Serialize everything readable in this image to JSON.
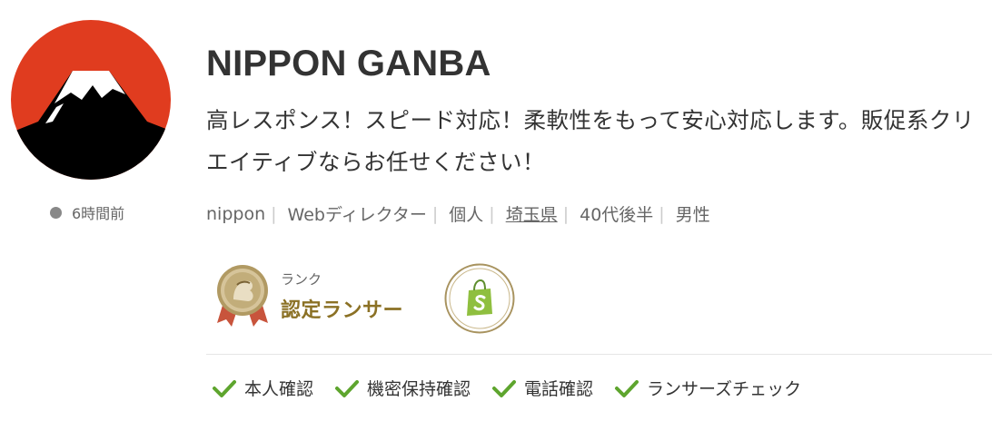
{
  "profile": {
    "name": "NIPPON GANBA",
    "catchphrase": "高レスポンス！スピード対応！柔軟性をもって安心対応します。販促系クリエイティブならお任せください！",
    "last_active": "6時間前"
  },
  "meta": {
    "username": "nippon",
    "occupation": "Webディレクター",
    "type": "個人",
    "location": "埼玉県",
    "age": "40代後半",
    "gender": "男性"
  },
  "rank": {
    "label": "ランク",
    "value": "認定ランサー"
  },
  "verifications": [
    {
      "label": "本人確認"
    },
    {
      "label": "機密保持確認"
    },
    {
      "label": "電話確認"
    },
    {
      "label": "ランサーズチェック"
    }
  ],
  "colors": {
    "avatar_red": "#e03c1f",
    "rank_gold": "#8b7125",
    "check_green": "#5ea52e"
  },
  "icons": {
    "avatar": "mount-fuji-icon",
    "medal": "rank-medal-icon",
    "badge": "shopify-bag-icon",
    "check": "checkmark-icon"
  }
}
